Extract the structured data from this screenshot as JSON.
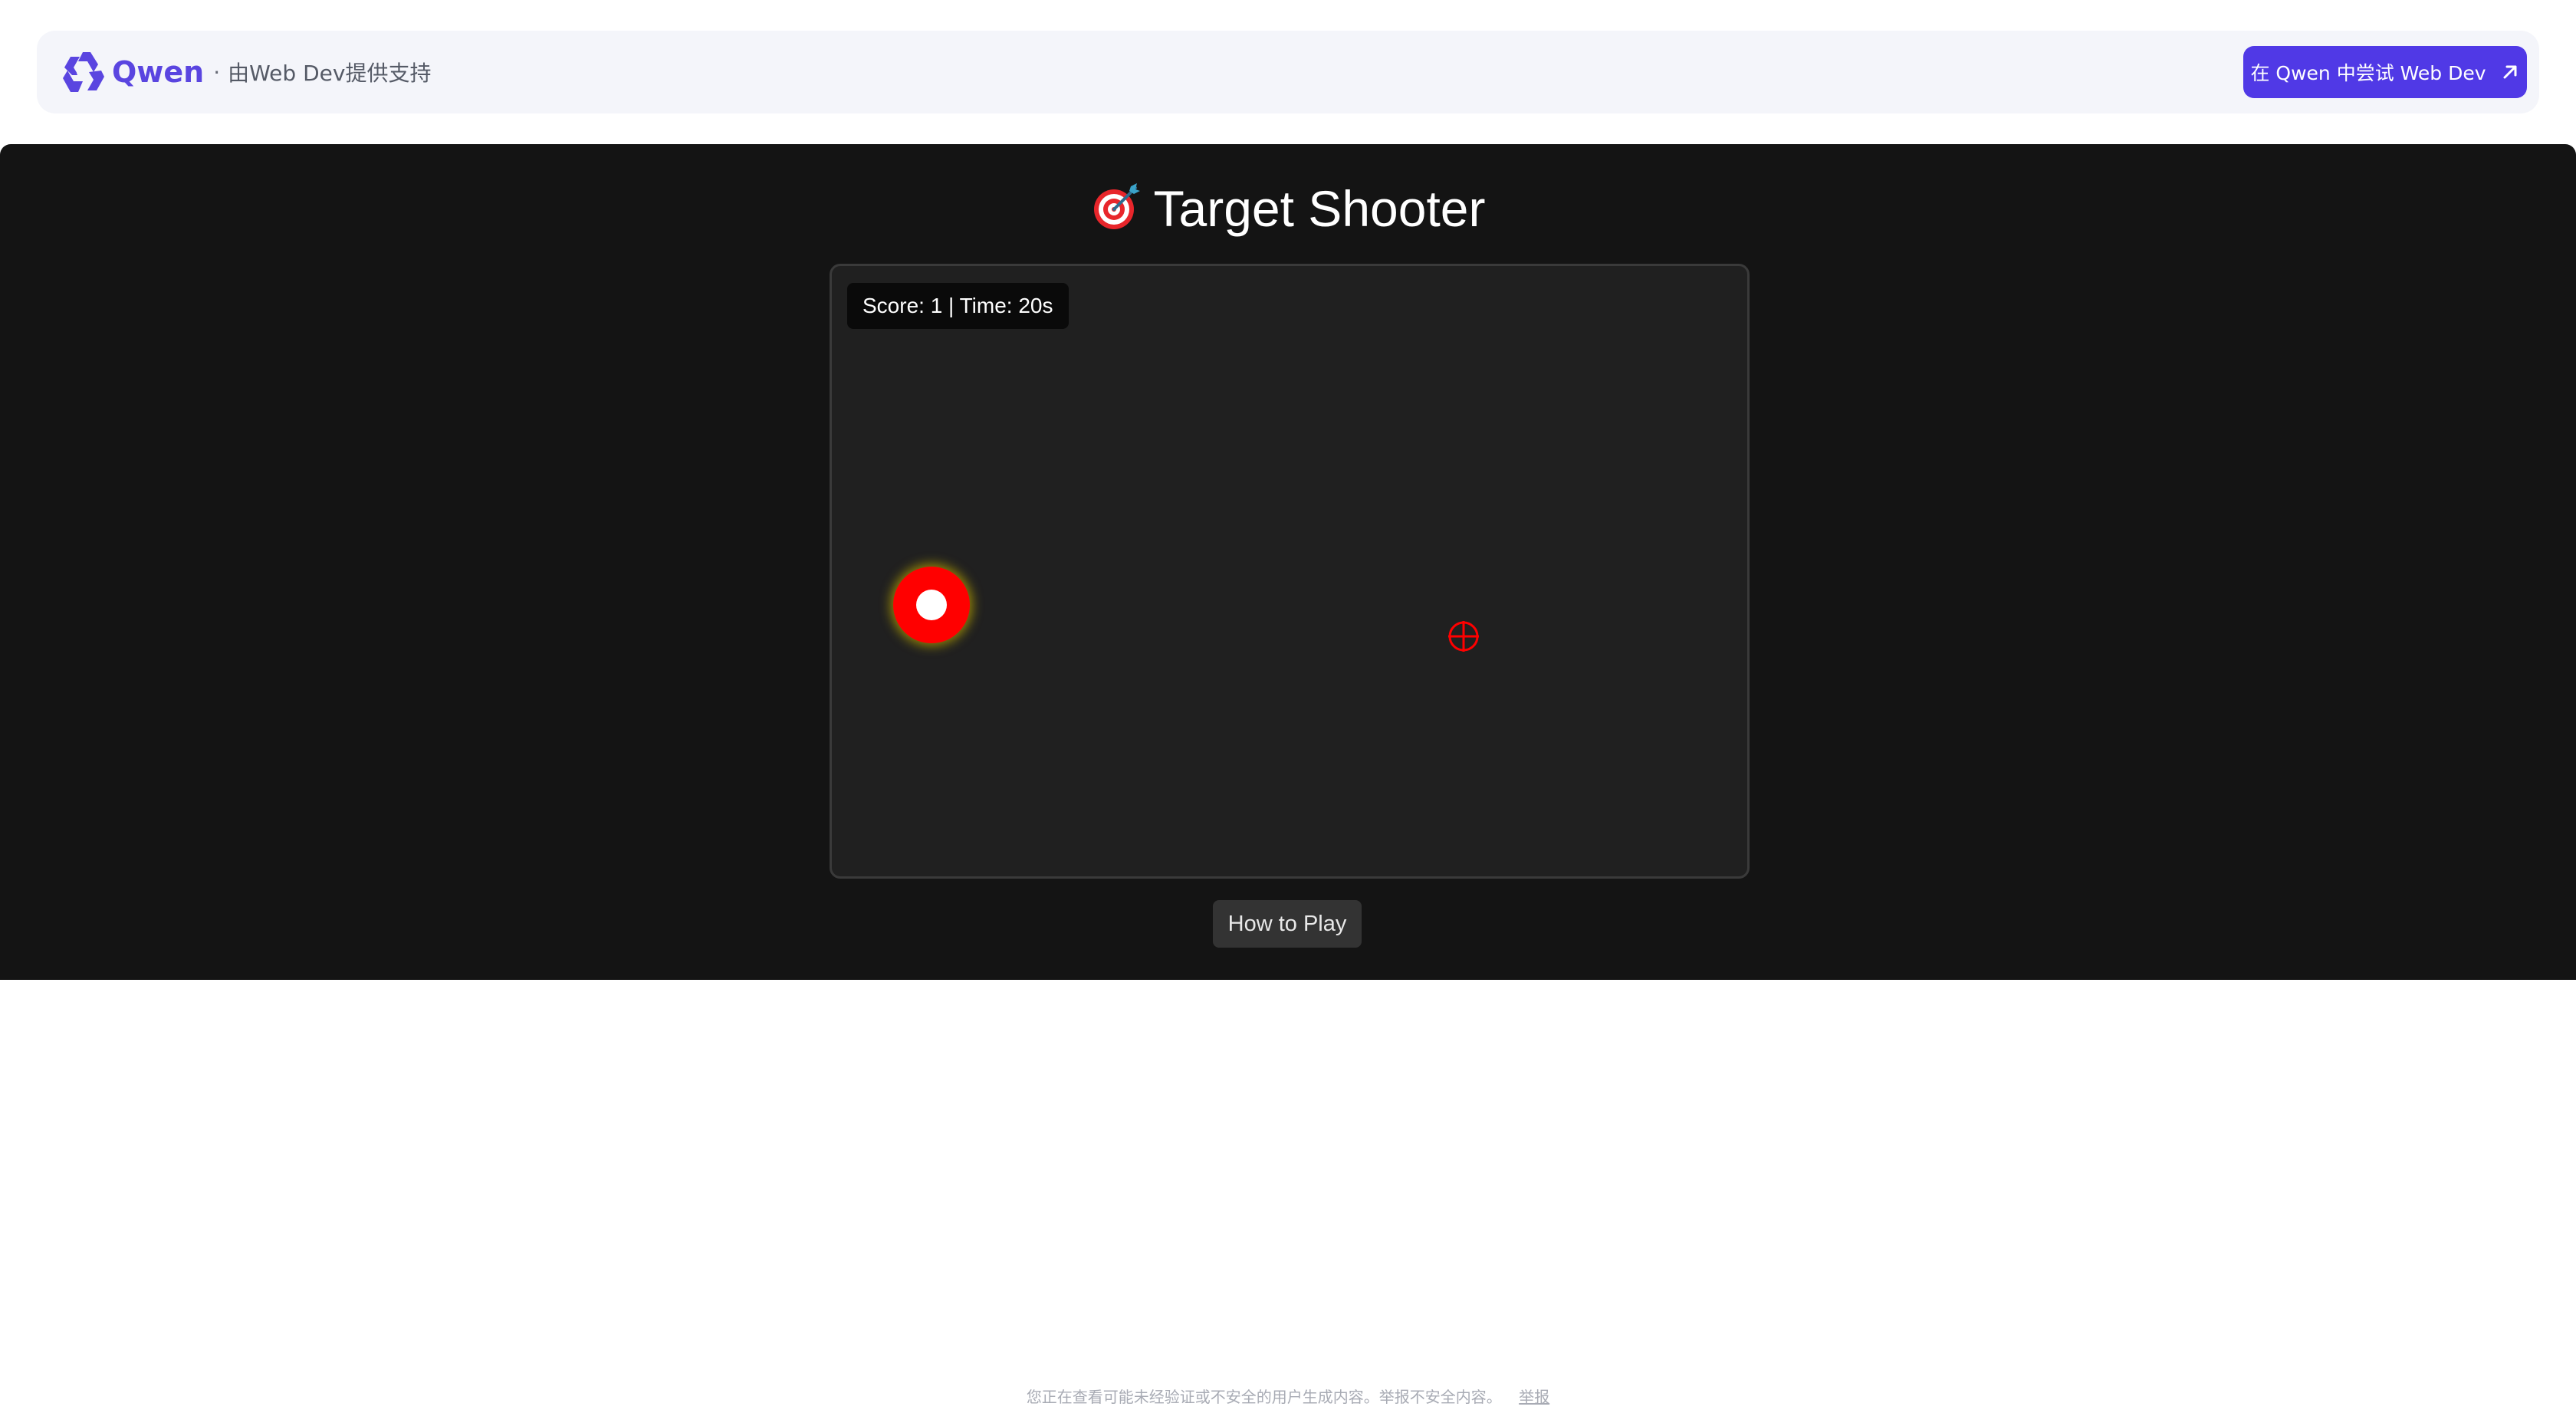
{
  "topbar": {
    "brand_name": "Qwen",
    "separator": "·",
    "tagline": "由Web Dev提供支持",
    "try_button_label": "在 Qwen 中尝试 Web Dev"
  },
  "app": {
    "title": "Target Shooter",
    "hud_text": "Score: 1 | Time: 20s",
    "howto_label": "How to Play"
  },
  "colors": {
    "brand": "#5039e6",
    "target": "#ff0000",
    "crosshair": "#ff0000",
    "app_bg": "#141414",
    "board_bg": "#202020"
  },
  "icons": {
    "logo": "qwen-logo-icon",
    "external": "arrow-up-right-icon",
    "title_emoji": "dart-target-icon",
    "crosshair": "crosshair-icon"
  },
  "footer": {
    "notice": "您正在查看可能未经验证或不安全的用户生成内容。举报不安全内容。",
    "report_label": "举报"
  }
}
